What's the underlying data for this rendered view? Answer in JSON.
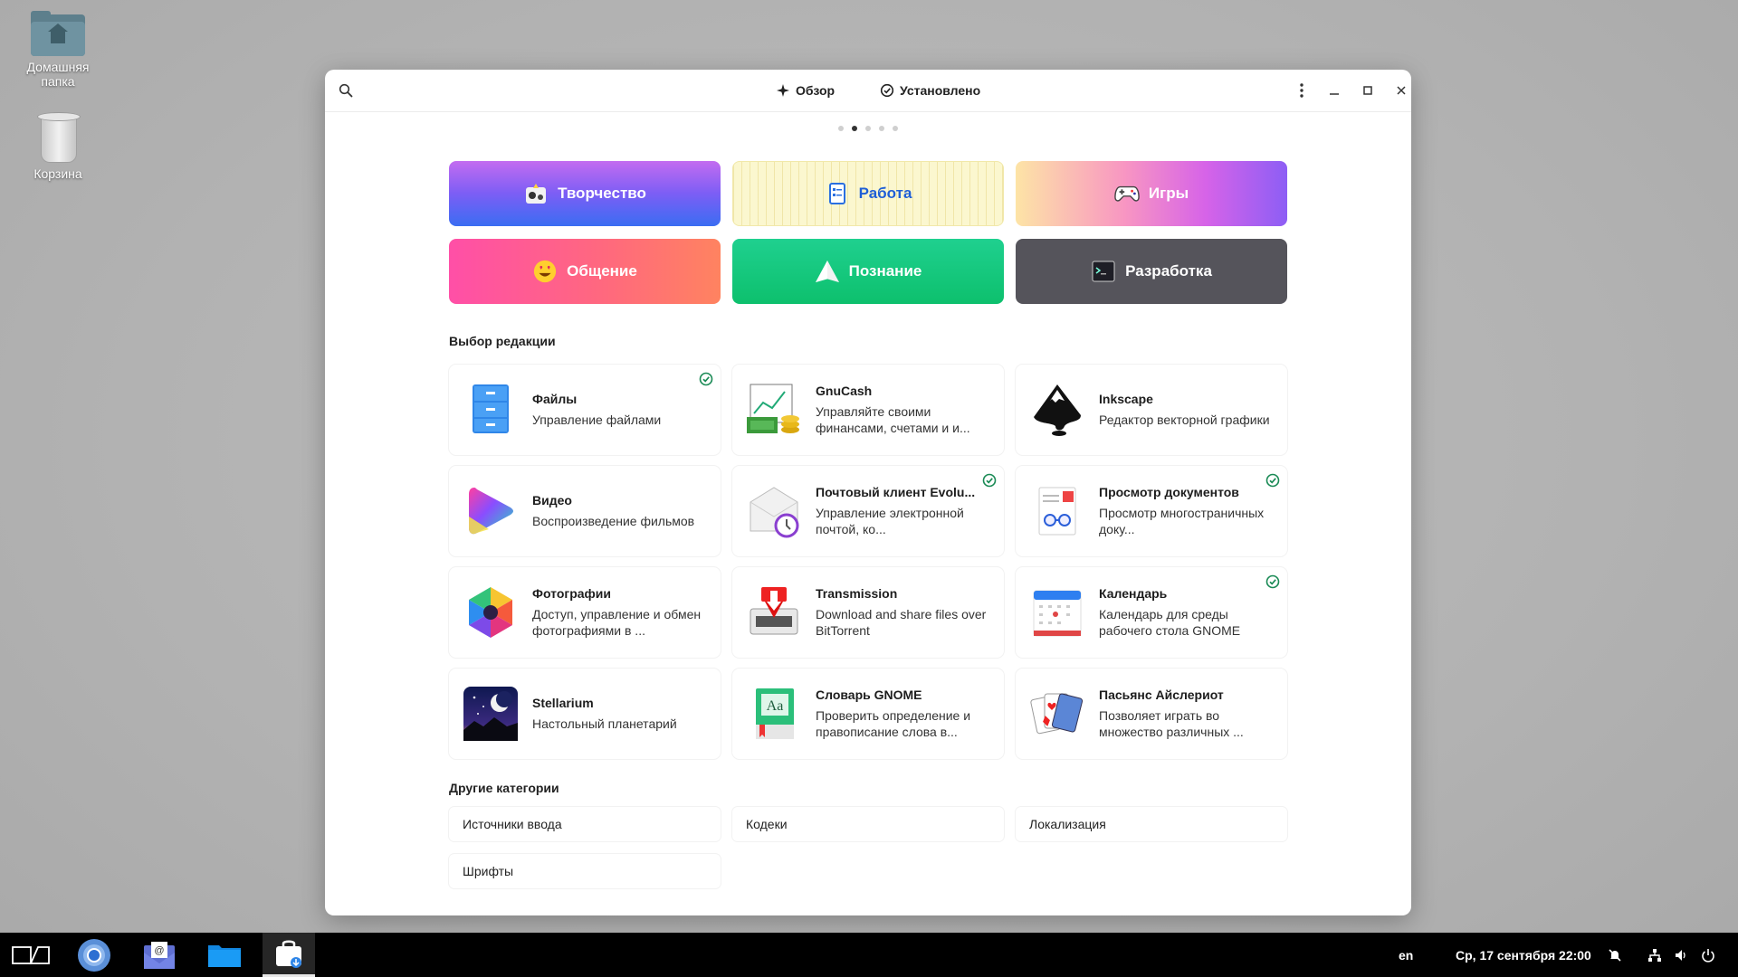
{
  "desktop": {
    "home_label": "Домашняя папка",
    "trash_label": "Корзина"
  },
  "window": {
    "nav": {
      "explore": "Обзор",
      "installed": "Установлено"
    },
    "pager": {
      "count": 5,
      "active": 2
    },
    "categories": [
      {
        "label": "Творчество",
        "icon": "creativity-icon"
      },
      {
        "label": "Работа",
        "icon": "work-icon"
      },
      {
        "label": "Игры",
        "icon": "gamepad-icon"
      },
      {
        "label": "Общение",
        "icon": "smiley-icon"
      },
      {
        "label": "Познание",
        "icon": "learning-icon"
      },
      {
        "label": "Разработка",
        "icon": "terminal-icon"
      }
    ],
    "editors_choice_title": "Выбор редакции",
    "apps": [
      {
        "name": "Файлы",
        "desc": "Управление файлами",
        "installed": true,
        "icon": "files-icon"
      },
      {
        "name": "GnuCash",
        "desc": "Управляйте своими финансами, счетами и и...",
        "installed": false,
        "icon": "gnucash-icon"
      },
      {
        "name": "Inkscape",
        "desc": "Редактор векторной графики",
        "installed": false,
        "icon": "inkscape-icon"
      },
      {
        "name": "Видео",
        "desc": "Воспроизведение фильмов",
        "installed": false,
        "icon": "video-icon"
      },
      {
        "name": "Почтовый клиент Evolu...",
        "desc": "Управление электронной почтой, ко...",
        "installed": true,
        "icon": "evolution-icon"
      },
      {
        "name": "Просмотр документов",
        "desc": "Просмотр многостраничных доку...",
        "installed": true,
        "icon": "document-viewer-icon"
      },
      {
        "name": "Фотографии",
        "desc": "Доступ, управление и обмен фотографиями в ...",
        "installed": false,
        "icon": "photos-icon"
      },
      {
        "name": "Transmission",
        "desc": "Download and share files over BitTorrent",
        "installed": false,
        "icon": "transmission-icon"
      },
      {
        "name": "Календарь",
        "desc": "Календарь для среды рабочего стола GNOME",
        "installed": true,
        "icon": "calendar-icon"
      },
      {
        "name": "Stellarium",
        "desc": "Настольный планетарий",
        "installed": false,
        "icon": "stellarium-icon"
      },
      {
        "name": "Словарь GNOME",
        "desc": "Проверить определение и правописание слова в...",
        "installed": false,
        "icon": "dictionary-icon"
      },
      {
        "name": "Пасьянс Айслериот",
        "desc": "Позволяет играть во множество различных ...",
        "installed": false,
        "icon": "solitaire-icon"
      }
    ],
    "other_title": "Другие категории",
    "other": [
      "Источники ввода",
      "Кодеки",
      "Локализация",
      "Шрифты"
    ]
  },
  "taskbar": {
    "lang": "en",
    "datetime": "Ср, 17 сентября  22:00"
  },
  "colors": {
    "accent_check": "#1a8a55",
    "taskbar_bg": "#000000"
  }
}
